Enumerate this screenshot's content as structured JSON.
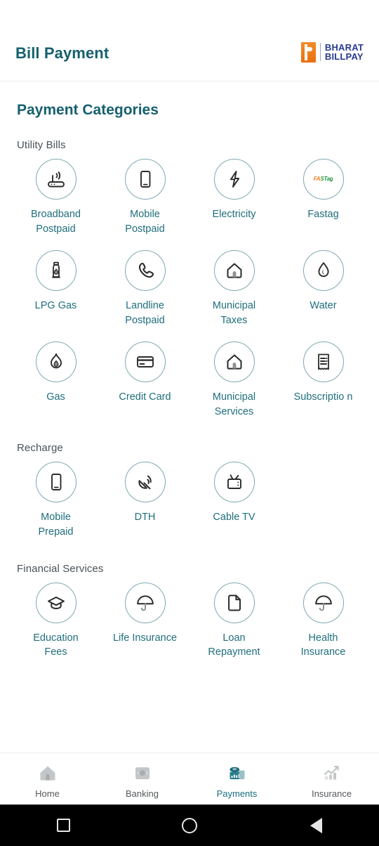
{
  "header": {
    "title": "Bill Payment",
    "logo": {
      "mark": "bharat-billpay-b-mark",
      "line1": "BHARAT",
      "line2": "BILLPAY"
    }
  },
  "main": {
    "page_title": "Payment Categories",
    "sections": [
      {
        "title": "Utility Bills",
        "items": [
          {
            "label": "Broadband Postpaid",
            "icon": "router-wifi-icon"
          },
          {
            "label": "Mobile Postpaid",
            "icon": "smartphone-icon"
          },
          {
            "label": "Electricity",
            "icon": "lightning-bolt-icon"
          },
          {
            "label": "Fastag",
            "icon": "fastag-logo-icon",
            "logo_text": "FASTag"
          },
          {
            "label": "LPG Gas",
            "icon": "gas-cylinder-icon"
          },
          {
            "label": "Landline Postpaid",
            "icon": "telephone-handset-icon"
          },
          {
            "label": "Municipal Taxes",
            "icon": "house-icon"
          },
          {
            "label": "Water",
            "icon": "water-droplet-icon"
          },
          {
            "label": "Gas",
            "icon": "flame-icon"
          },
          {
            "label": "Credit Card",
            "icon": "credit-card-icon"
          },
          {
            "label": "Municipal Services",
            "icon": "house-icon"
          },
          {
            "label": "Subscriptio n",
            "icon": "receipt-icon"
          }
        ]
      },
      {
        "title": "Recharge",
        "items": [
          {
            "label": "Mobile Prepaid",
            "icon": "smartphone-icon"
          },
          {
            "label": "DTH",
            "icon": "satellite-dish-icon"
          },
          {
            "label": "Cable TV",
            "icon": "television-icon"
          }
        ]
      },
      {
        "title": "Financial Services",
        "items": [
          {
            "label": "Education Fees",
            "icon": "graduation-cap-icon"
          },
          {
            "label": "Life Insurance",
            "icon": "umbrella-icon"
          },
          {
            "label": "Loan Repayment",
            "icon": "document-icon"
          },
          {
            "label": "Health Insurance",
            "icon": "umbrella-icon"
          }
        ]
      }
    ]
  },
  "tabbar": {
    "active": "Payments",
    "tabs": [
      {
        "label": "Home",
        "icon": "home-icon"
      },
      {
        "label": "Banking",
        "icon": "bank-building-icon"
      },
      {
        "label": "Payments",
        "icon": "payments-stack-icon"
      },
      {
        "label": "Insurance",
        "icon": "growth-chart-icon"
      }
    ]
  },
  "system_nav": {
    "recents": "recents-square-icon",
    "home": "home-circle-icon",
    "back": "back-triangle-icon"
  },
  "colors": {
    "brand_teal": "#16606e",
    "tile_label": "#1f6e7c",
    "circle_border": "#7ea9b2",
    "section_title": "#4b5258",
    "logo_orange": "#ee7d1c",
    "logo_navy": "#2b3a8f"
  }
}
